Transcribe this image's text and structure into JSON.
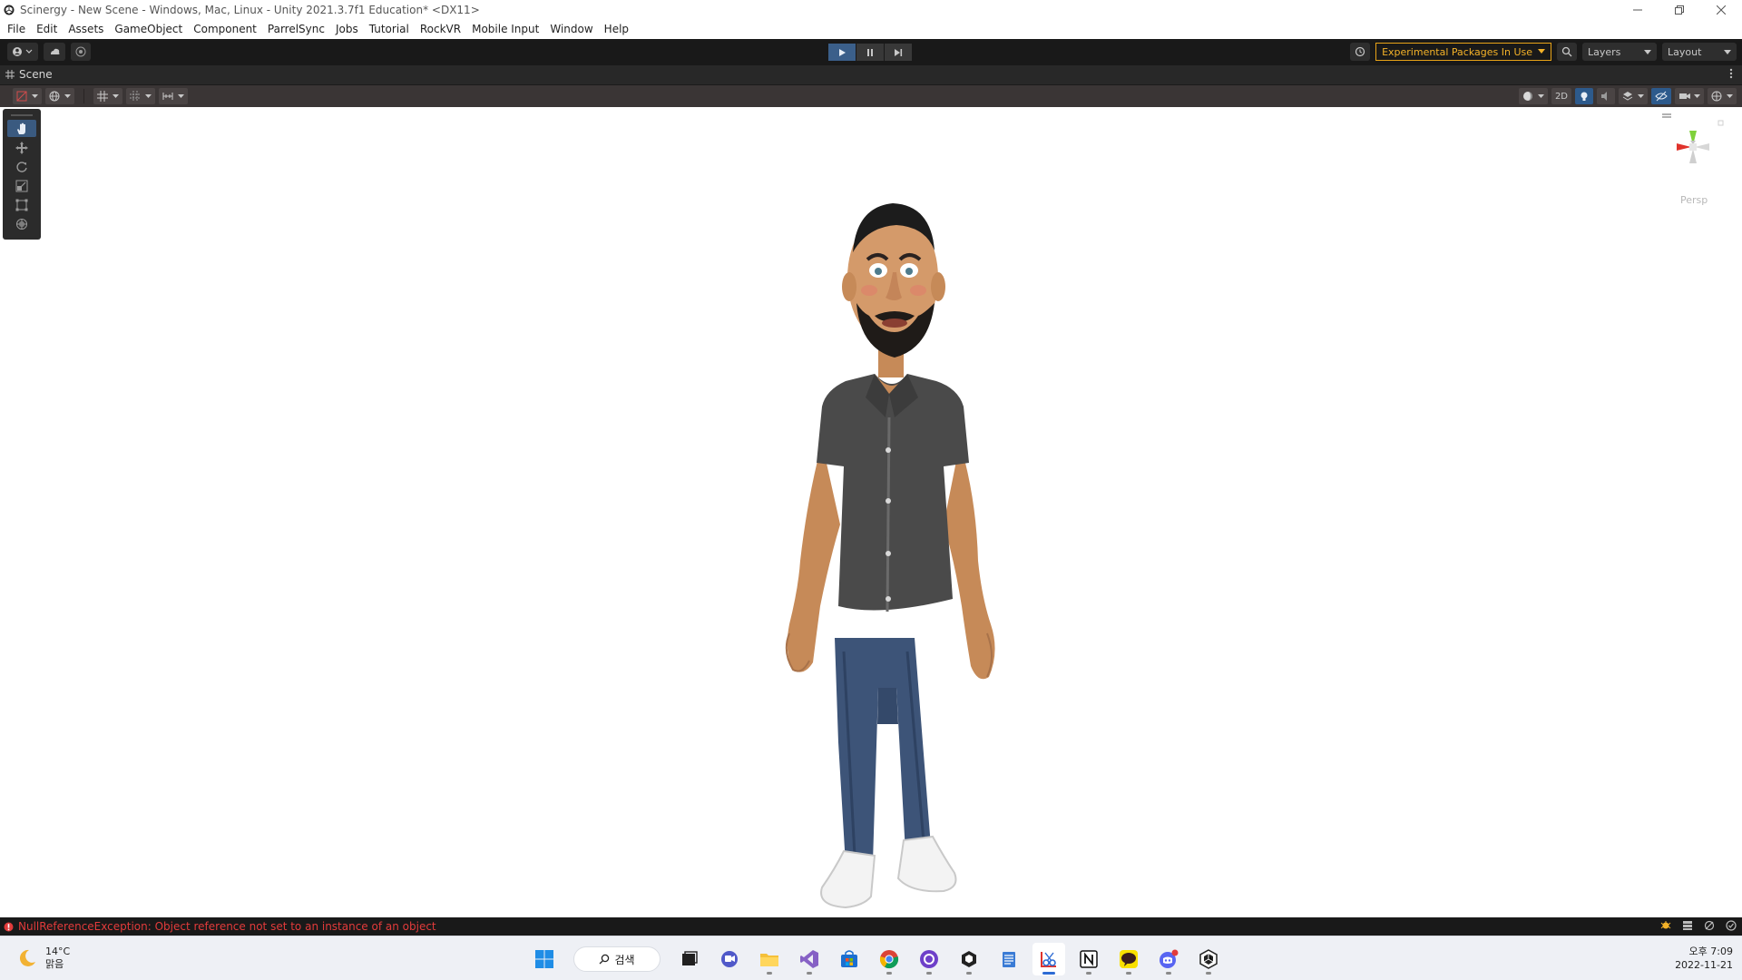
{
  "window": {
    "title": "Scinergy - New Scene - Windows, Mac, Linux - Unity 2021.3.7f1 Education* <DX11>"
  },
  "menu": [
    "File",
    "Edit",
    "Assets",
    "GameObject",
    "Component",
    "ParrelSync",
    "Jobs",
    "Tutorial",
    "RockVR",
    "Mobile Input",
    "Window",
    "Help"
  ],
  "toolbar": {
    "experimental_label": "Experimental Packages In Use",
    "layers_label": "Layers",
    "layout_label": "Layout"
  },
  "scene": {
    "tab_label": "Scene",
    "mode_2d_label": "2D",
    "gizmo_projection": "Persp"
  },
  "status": {
    "error_message": "NullReferenceException: Object reference not set to an instance of an object",
    "error_color": "#e23b3b"
  },
  "taskbar": {
    "weather_temp": "14°C",
    "weather_desc": "맑음",
    "search_label": "검색",
    "time": "오후 7:09",
    "date": "2022-11-21"
  },
  "colors": {
    "accent": "#3b5f8a",
    "warning": "#f4b228"
  }
}
